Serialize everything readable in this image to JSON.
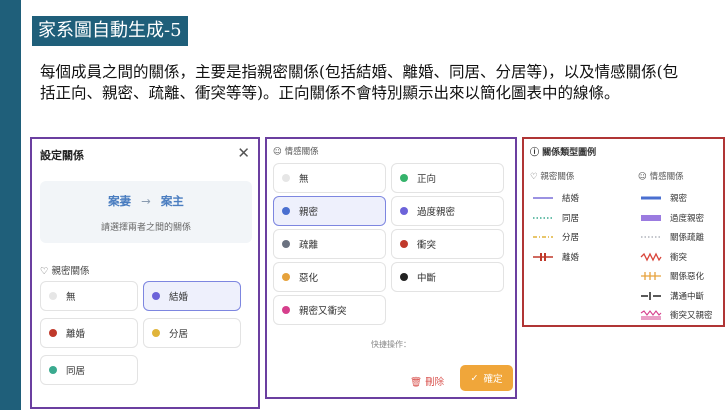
{
  "slide": {
    "title": "家系圖自動生成-5",
    "body": "每個成員之間的關係，主要是指親密關係(包括結婚、離婚、同居、分居等)，以及情感關係(包括正向、親密、疏離、衝突等等)。正向關係不會特別顯示出來以簡化圖表中的線條。"
  },
  "relation_dialog": {
    "title": "設定關係",
    "close_glyph": "✕",
    "from_name": "案妻",
    "arrow": "→",
    "to_name": "案主",
    "hint": "請選擇兩者之間的關係",
    "section_label": "親密關係",
    "options": [
      {
        "label": "無",
        "color": "#e6e6e6",
        "selected": false
      },
      {
        "label": "結婚",
        "color": "#6c63d9",
        "selected": true
      },
      {
        "label": "離婚",
        "color": "#c0392b",
        "selected": false
      },
      {
        "label": "分居",
        "color": "#e0b43a",
        "selected": false
      },
      {
        "label": "同居",
        "color": "#3aaa8f",
        "selected": false
      }
    ]
  },
  "emotion_panel": {
    "section_label": "情感關係",
    "options": [
      {
        "label": "無",
        "color": "#e6e6e6",
        "selected": false
      },
      {
        "label": "正向",
        "color": "#35b36b",
        "selected": false
      },
      {
        "label": "親密",
        "color": "#4a6fd0",
        "selected": true
      },
      {
        "label": "過度親密",
        "color": "#6c63d9",
        "selected": false
      },
      {
        "label": "疏離",
        "color": "#6b7280",
        "selected": false
      },
      {
        "label": "衝突",
        "color": "#c0392b",
        "selected": false
      },
      {
        "label": "惡化",
        "color": "#e6a23c",
        "selected": false
      },
      {
        "label": "中斷",
        "color": "#222222",
        "selected": false
      },
      {
        "label": "親密又衝突",
        "color": "#d63f8c",
        "selected": false
      }
    ],
    "quick_label": "快捷操作：",
    "delete_label": "刪除",
    "confirm_label": "確定",
    "confirm_color": "#f0a63a"
  },
  "legend": {
    "title": "關係類型圖例",
    "intimate_title": "親密關係",
    "emotional_title": "情感關係",
    "intimate_items": [
      {
        "label": "結婚",
        "style": "solid",
        "color": "#7a6fd9"
      },
      {
        "label": "同居",
        "style": "dotted",
        "color": "#3aaa8f"
      },
      {
        "label": "分居",
        "style": "dash-dot",
        "color": "#e0b43a"
      },
      {
        "label": "離婚",
        "style": "slashed",
        "color": "#c0392b"
      }
    ],
    "emotional_items": [
      {
        "label": "親密",
        "style": "thick",
        "color": "#4a6fd0"
      },
      {
        "label": "過度親密",
        "style": "double-thick",
        "color": "#9b7be0"
      },
      {
        "label": "關係疏離",
        "style": "dotted",
        "color": "#b0b4bb"
      },
      {
        "label": "衝突",
        "style": "zigzag",
        "color": "#d9453a"
      },
      {
        "label": "關係惡化",
        "style": "hatched",
        "color": "#e6a23c"
      },
      {
        "label": "溝通中斷",
        "style": "broken",
        "color": "#222222"
      },
      {
        "label": "衝突又親密",
        "style": "zigzag-double",
        "color": "#d63f8c"
      }
    ]
  }
}
